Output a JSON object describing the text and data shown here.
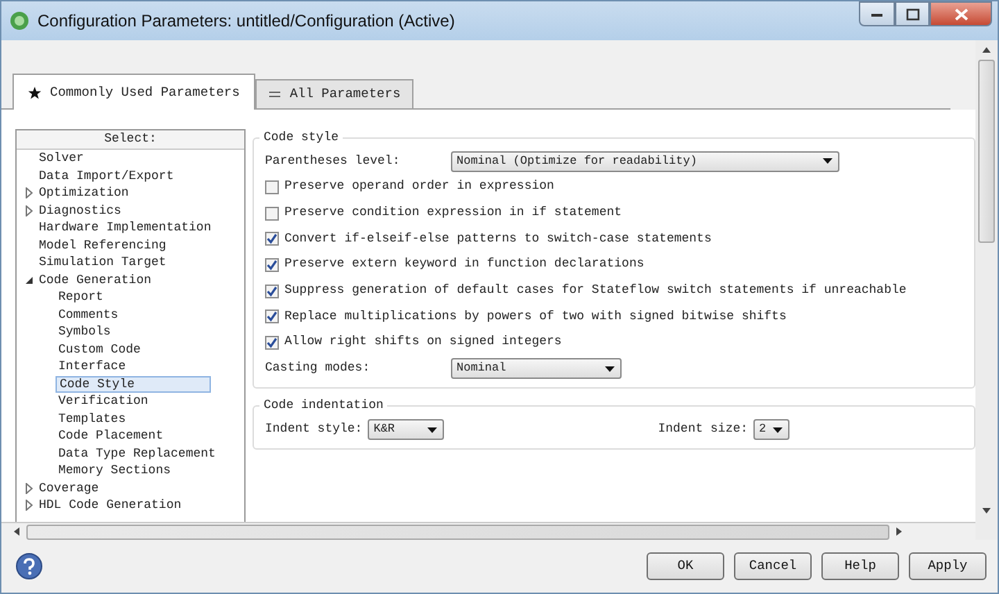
{
  "window": {
    "title": "Configuration Parameters: untitled/Configuration (Active)"
  },
  "tabs": [
    {
      "label": "Commonly Used Parameters",
      "kind": "favorites",
      "selected": true
    },
    {
      "label": "All Parameters",
      "kind": "list",
      "selected": false
    }
  ],
  "tree": {
    "header": "Select:",
    "items": [
      {
        "label": "Solver",
        "selected": false
      },
      {
        "label": "Data Import/Export",
        "selected": false
      },
      {
        "label": "Optimization",
        "selected": false,
        "expanded": false
      },
      {
        "label": "Diagnostics",
        "selected": false,
        "expanded": false
      },
      {
        "label": "Hardware Implementation",
        "selected": false
      },
      {
        "label": "Model Referencing",
        "selected": false
      },
      {
        "label": "Simulation Target",
        "selected": false
      },
      {
        "label": "Code Generation",
        "selected": false,
        "expanded": true,
        "children": [
          {
            "label": "Report",
            "selected": false
          },
          {
            "label": "Comments",
            "selected": false
          },
          {
            "label": "Symbols",
            "selected": false
          },
          {
            "label": "Custom Code",
            "selected": false
          },
          {
            "label": "Interface",
            "selected": false
          },
          {
            "label": "Code Style",
            "selected": true
          },
          {
            "label": "Verification",
            "selected": false
          },
          {
            "label": "Templates",
            "selected": false
          },
          {
            "label": "Code Placement",
            "selected": false
          },
          {
            "label": "Data Type Replacement",
            "selected": false
          },
          {
            "label": "Memory Sections",
            "selected": false
          }
        ]
      },
      {
        "label": "Coverage",
        "selected": false,
        "expanded": false
      },
      {
        "label": "HDL Code Generation",
        "selected": false,
        "expanded": false
      }
    ]
  },
  "sections": [
    {
      "title": "Code style",
      "rows": [
        {
          "kind": "dropdown",
          "label": "Parentheses level:",
          "value": "Nominal (Optimize for readability)"
        },
        {
          "kind": "checkbox",
          "label": "Preserve operand order in expression",
          "checked": false
        },
        {
          "kind": "checkbox",
          "label": "Preserve condition expression in if statement",
          "checked": false
        },
        {
          "kind": "checkbox",
          "label": "Convert if-elseif-else patterns to switch-case statements",
          "checked": true
        },
        {
          "kind": "checkbox",
          "label": "Preserve extern keyword in function declarations",
          "checked": true
        },
        {
          "kind": "checkbox",
          "label": "Suppress generation of default cases for Stateflow switch statements if unreachable",
          "checked": true
        },
        {
          "kind": "checkbox",
          "label": "Replace multiplications by powers of two with signed bitwise shifts",
          "checked": true
        },
        {
          "kind": "checkbox",
          "label": "Allow right shifts on signed integers",
          "checked": true
        },
        {
          "kind": "dropdown",
          "label": "Casting modes:",
          "value": "Nominal"
        }
      ]
    },
    {
      "title": "Code indentation",
      "rows": [
        {
          "kind": "pair",
          "fields": [
            {
              "label": "Indent style:",
              "value": "K&R"
            },
            {
              "label": "Indent size:",
              "value": "2"
            }
          ]
        }
      ]
    }
  ],
  "buttons": [
    "OK",
    "Cancel",
    "Help",
    "Apply"
  ]
}
